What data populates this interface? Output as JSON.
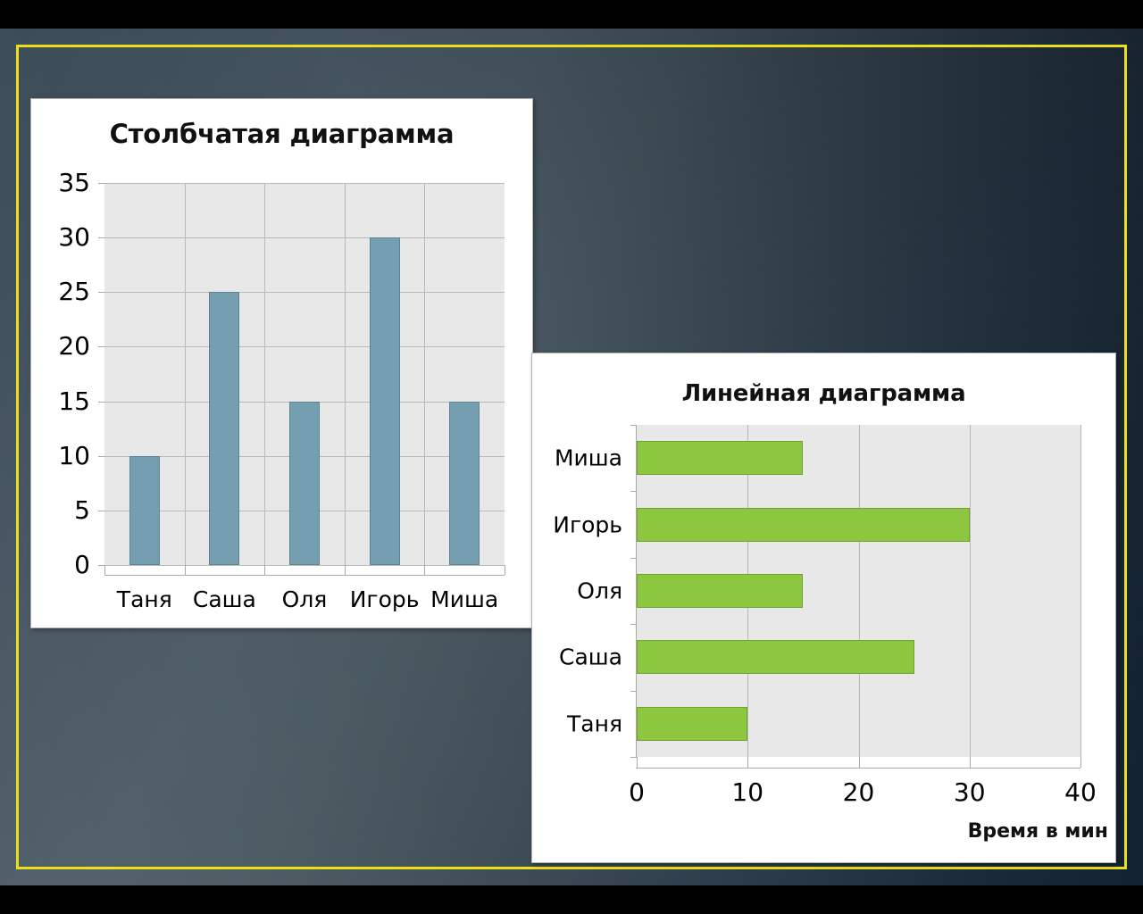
{
  "slide": {
    "background_outer": "#000000",
    "background_gradient_from": "#4a5964",
    "background_gradient_to": "#152637",
    "border_color": "#e9e01a"
  },
  "charts": {
    "column": {
      "title": "Столбчатая диаграмма",
      "bar_color": "#759FB0",
      "plot_bg": "#e8e8e8"
    },
    "bar": {
      "title": "Линейная диаграмма",
      "axis_title": "Время в мин",
      "bar_color": "#8DC63F",
      "plot_bg": "#e8e8e8"
    }
  },
  "chart_data": [
    {
      "type": "bar",
      "orientation": "vertical",
      "title": "Столбчатая диаграмма",
      "categories": [
        "Таня",
        "Саша",
        "Оля",
        "Игорь",
        "Миша"
      ],
      "values": [
        10,
        25,
        15,
        30,
        15
      ],
      "ylim": [
        0,
        35
      ],
      "yticks": [
        0,
        5,
        10,
        15,
        20,
        25,
        30,
        35
      ],
      "ytick_labels": [
        "0",
        "5",
        "10",
        "15",
        "20",
        "25",
        "30",
        "35"
      ],
      "xlabel": "",
      "ylabel": "",
      "grid": true,
      "legend": false,
      "series_color": "#759FB0"
    },
    {
      "type": "bar",
      "orientation": "horizontal",
      "title": "Линейная диаграмма",
      "categories": [
        "Таня",
        "Саша",
        "Оля",
        "Игорь",
        "Миша"
      ],
      "values": [
        10,
        25,
        15,
        30,
        15
      ],
      "xlim": [
        0,
        40
      ],
      "xticks": [
        0,
        10,
        20,
        30,
        40
      ],
      "xtick_labels": [
        "0",
        "10",
        "20",
        "30",
        "40"
      ],
      "xlabel": "Время в мин",
      "ylabel": "",
      "grid": true,
      "legend": false,
      "series_color": "#8DC63F"
    }
  ]
}
